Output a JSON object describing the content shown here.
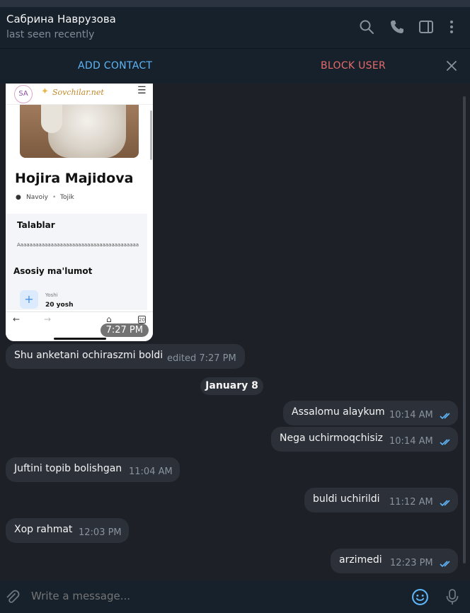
{
  "chat": {
    "name": "Сабрина Наврузова",
    "status": "last seen recently"
  },
  "header_icons": [
    "search-icon",
    "phone-icon",
    "sidebar-toggle-icon",
    "more-vertical-icon"
  ],
  "action_bar": {
    "add_contact": "ADD CONTACT",
    "block_user": "BLOCK USER"
  },
  "photo_message": {
    "site_logo": "Sovchilar.net",
    "profile_name": "Hojira Majidova",
    "location": "Navoiy",
    "ethnicity": "Tojik",
    "section_title": "Talablar",
    "section_text": "Aaaaaaaaaaaaaaaaaaaaaaaaaaaaaaaaaaaaaaaa",
    "info_title": "Asosiy ma'lumot",
    "age_label": "Yoshi",
    "age_value": "20 yosh",
    "tabs_count": "20",
    "time": "7:27 PM"
  },
  "messages": [
    {
      "text": "Shu anketani ochiraszmi boldi",
      "time": "edited 7:27 PM",
      "outgoing": false
    },
    {
      "text": "Assalomu alaykum",
      "time": "10:14 AM",
      "outgoing": true
    },
    {
      "text": "Nega uchirmoqchisiz",
      "time": "10:14 AM",
      "outgoing": true
    },
    {
      "text": "Juftini topib bolishgan",
      "time": "11:04 AM",
      "outgoing": false
    },
    {
      "text": "buldi uchirildi",
      "time": "11:12 AM",
      "outgoing": true
    },
    {
      "text": "Xop rahmat",
      "time": "12:03 PM",
      "outgoing": false
    },
    {
      "text": "arzimedi",
      "time": "12:23 PM",
      "outgoing": true
    }
  ],
  "date_separator": "January 8",
  "composer": {
    "placeholder": "Write a message..."
  },
  "colors": {
    "accent": "#5eb5f7",
    "danger": "#e66b6b",
    "bubble": "#2b3039",
    "read_checks": "#5eb5f7"
  }
}
